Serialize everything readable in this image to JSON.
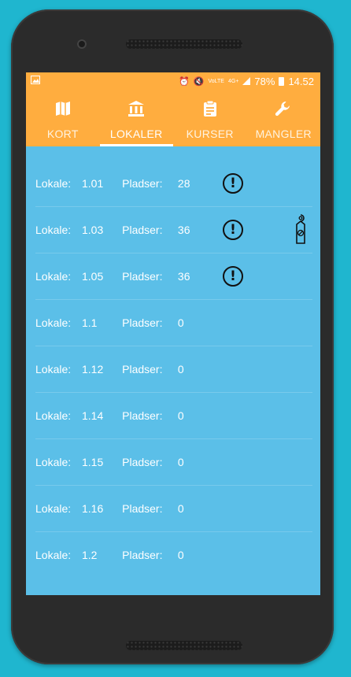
{
  "statusbar": {
    "battery": "78%",
    "time": "14.52",
    "network": "4G+",
    "volte": "VoLTE"
  },
  "tabs": [
    {
      "label": "KORT",
      "icon": "map-icon",
      "active": false
    },
    {
      "label": "LOKALER",
      "icon": "building-icon",
      "active": true
    },
    {
      "label": "KURSER",
      "icon": "clipboard-icon",
      "active": false
    },
    {
      "label": "MANGLER",
      "icon": "wrench-icon",
      "active": false
    }
  ],
  "labels": {
    "room": "Lokale:",
    "seats": "Pladser:"
  },
  "rooms": [
    {
      "room": "1.01",
      "seats": "28",
      "warning": true,
      "door_hanger": false
    },
    {
      "room": "1.03",
      "seats": "36",
      "warning": true,
      "door_hanger": true
    },
    {
      "room": "1.05",
      "seats": "36",
      "warning": true,
      "door_hanger": false
    },
    {
      "room": "1.1",
      "seats": "0",
      "warning": false,
      "door_hanger": false
    },
    {
      "room": "1.12",
      "seats": "0",
      "warning": false,
      "door_hanger": false
    },
    {
      "room": "1.14",
      "seats": "0",
      "warning": false,
      "door_hanger": false
    },
    {
      "room": "1.15",
      "seats": "0",
      "warning": false,
      "door_hanger": false
    },
    {
      "room": "1.16",
      "seats": "0",
      "warning": false,
      "door_hanger": false
    },
    {
      "room": "1.2",
      "seats": "0",
      "warning": false,
      "door_hanger": false
    }
  ],
  "colors": {
    "accent": "#ffad3f",
    "background": "#5bbfe8",
    "frame": "#1fb6cf"
  }
}
